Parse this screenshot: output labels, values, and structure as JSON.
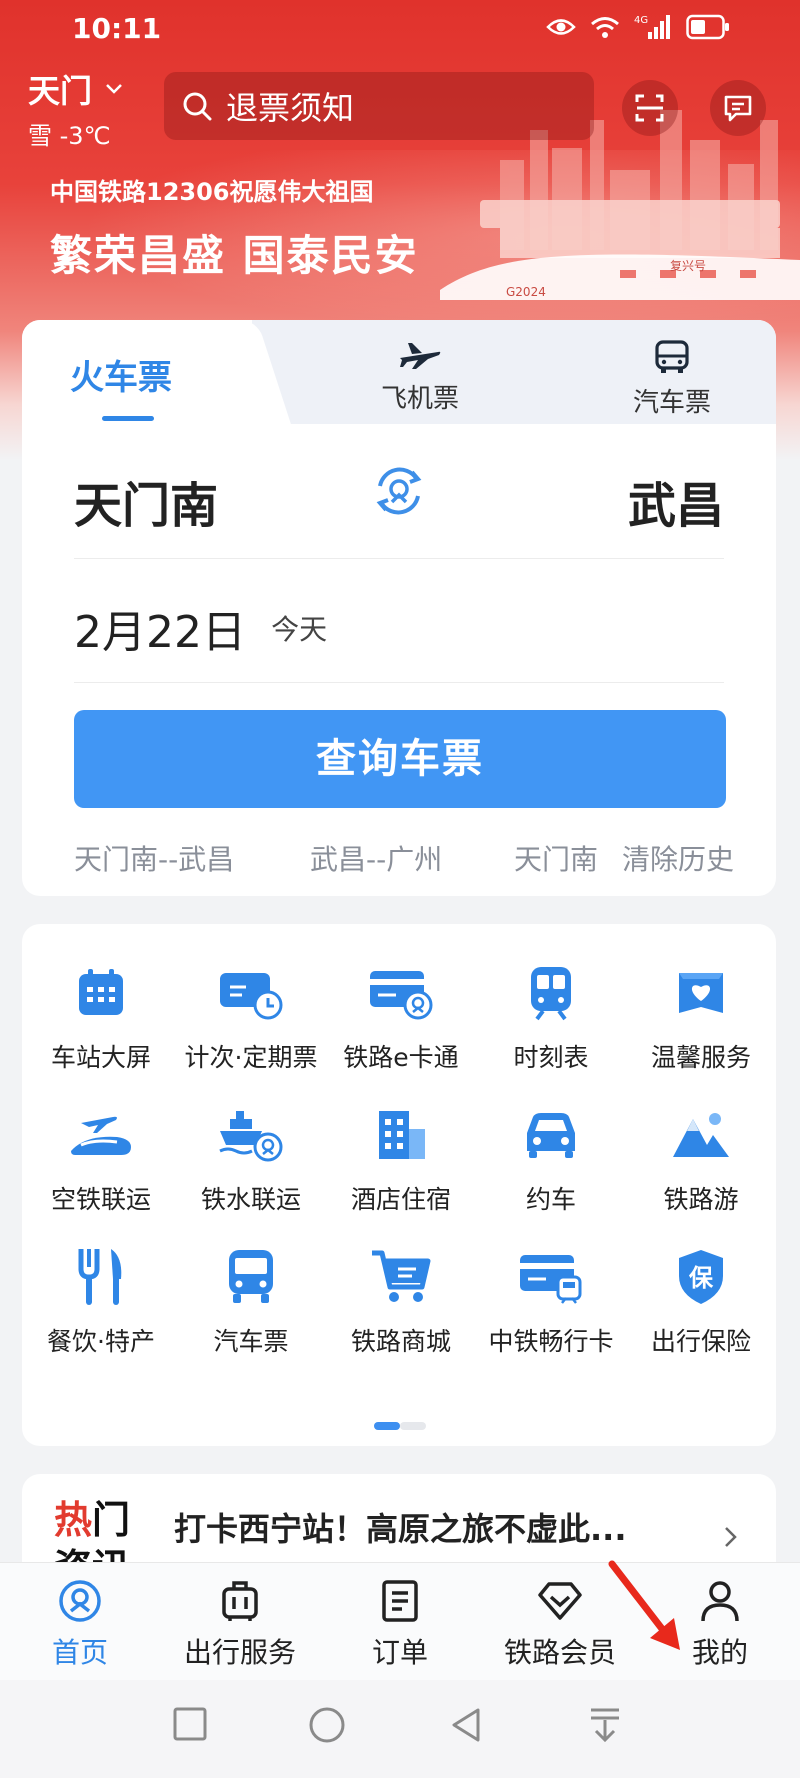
{
  "status_bar": {
    "time": "10:11",
    "network": "4G"
  },
  "header": {
    "city": "天门",
    "weather": "雪 -3℃",
    "search_placeholder": "退票须知"
  },
  "banner": {
    "line1": "中国铁路12306祝愿伟大祖国",
    "line2": "繁荣昌盛 国泰民安",
    "train_tag": "G2024",
    "train_name": "复兴号"
  },
  "ticket": {
    "tabs": [
      {
        "label": "火车票",
        "icon": "train"
      },
      {
        "label": "飞机票",
        "icon": "airplane-icon"
      },
      {
        "label": "汽车票",
        "icon": "bus-icon"
      }
    ],
    "from": "天门南",
    "to": "武昌",
    "date": "2月22日",
    "date_note": "今天",
    "search_button": "查询车票",
    "history": [
      "天门南--武昌",
      "武昌--广州",
      "天门南"
    ],
    "clear_history": "清除历史"
  },
  "services": [
    {
      "label": "车站大屏",
      "icon": "calendar-grid-icon"
    },
    {
      "label": "计次·定期票",
      "icon": "ticket-clock-icon"
    },
    {
      "label": "铁路e卡通",
      "icon": "card-train-icon"
    },
    {
      "label": "时刻表",
      "icon": "train-front-icon"
    },
    {
      "label": "温馨服务",
      "icon": "heart-box-icon"
    },
    {
      "label": "空铁联运",
      "icon": "plane-train-icon"
    },
    {
      "label": "铁水联运",
      "icon": "ship-train-icon"
    },
    {
      "label": "酒店住宿",
      "icon": "hotel-icon"
    },
    {
      "label": "约车",
      "icon": "car-icon"
    },
    {
      "label": "铁路游",
      "icon": "mountain-icon"
    },
    {
      "label": "餐饮·特产",
      "icon": "fork-knife-icon"
    },
    {
      "label": "汽车票",
      "icon": "bus-icon"
    },
    {
      "label": "铁路商城",
      "icon": "cart-icon"
    },
    {
      "label": "中铁畅行卡",
      "icon": "card-train2-icon"
    },
    {
      "label": "出行保险",
      "icon": "shield-bao-icon"
    }
  ],
  "services_page": {
    "current": 1,
    "total": 2
  },
  "news": {
    "badge_line1": "热门",
    "badge_line2": "资讯",
    "title": "打卡西宁站！高原之旅不虚此..."
  },
  "bottom_nav": [
    {
      "label": "首页",
      "icon": "home-train-icon",
      "active": true
    },
    {
      "label": "出行服务",
      "icon": "luggage-icon",
      "active": false
    },
    {
      "label": "订单",
      "icon": "order-icon",
      "active": false
    },
    {
      "label": "铁路会员",
      "icon": "diamond-icon",
      "active": false
    },
    {
      "label": "我的",
      "icon": "person-icon",
      "active": false
    }
  ],
  "colors": {
    "accent": "#2f86e6",
    "button": "#4196f4",
    "banner_red": "#e0322c",
    "annotation_arrow": "#e8291c"
  }
}
